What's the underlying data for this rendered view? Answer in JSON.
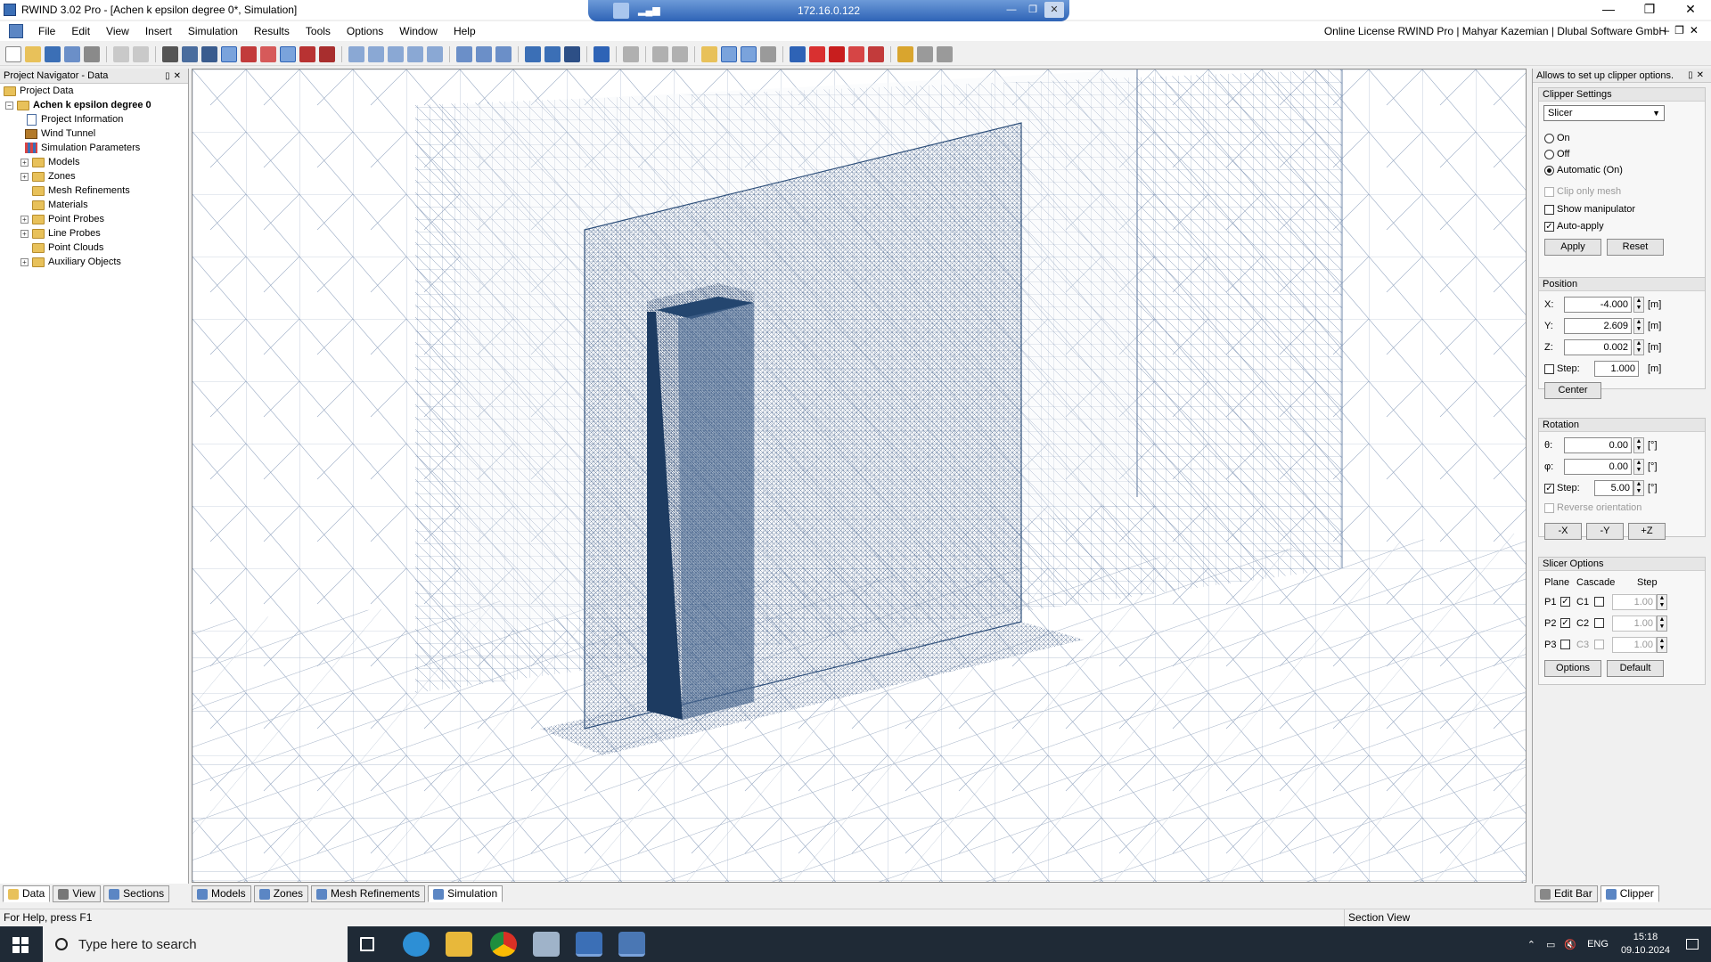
{
  "window": {
    "title": "RWIND 3.02 Pro - [Achen  k epsilon degree 0*, Simulation]",
    "remote_ip": "172.16.0.122"
  },
  "menu": {
    "items": [
      "File",
      "Edit",
      "View",
      "Insert",
      "Simulation",
      "Results",
      "Tools",
      "Options",
      "Window",
      "Help"
    ],
    "license": "Online License RWIND Pro | Mahyar Kazemian | Dlubal Software GmbH"
  },
  "navigator": {
    "title": "Project Navigator - Data",
    "root": "Project Data",
    "project": "Achen  k epsilon degree 0",
    "items": [
      {
        "label": "Project Information",
        "icon": "document-icon"
      },
      {
        "label": "Wind Tunnel",
        "icon": "wind-tunnel-icon"
      },
      {
        "label": "Simulation Parameters",
        "icon": "parameters-icon"
      },
      {
        "label": "Models",
        "icon": "folder-icon"
      },
      {
        "label": "Zones",
        "icon": "folder-icon"
      },
      {
        "label": "Mesh Refinements",
        "icon": "folder-icon"
      },
      {
        "label": "Materials",
        "icon": "folder-icon"
      },
      {
        "label": "Point Probes",
        "icon": "folder-icon"
      },
      {
        "label": "Line Probes",
        "icon": "folder-icon"
      },
      {
        "label": "Point Clouds",
        "icon": "folder-icon"
      },
      {
        "label": "Auxiliary Objects",
        "icon": "folder-icon"
      }
    ]
  },
  "clipper": {
    "panel_title": "Allows to set up clipper options.",
    "settings_title": "Clipper Settings",
    "mode": "Slicer",
    "radio_on": "On",
    "radio_off": "Off",
    "radio_auto": "Automatic (On)",
    "clip_only_mesh": "Clip only mesh",
    "show_manipulator": "Show manipulator",
    "auto_apply": "Auto-apply",
    "apply": "Apply",
    "reset": "Reset",
    "position_title": "Position",
    "x_label": "X:",
    "x_value": "-4.000",
    "y_label": "Y:",
    "y_value": "2.609",
    "z_label": "Z:",
    "z_value": "0.002",
    "step_label": "Step:",
    "step_value": "1.000",
    "unit_m": "[m]",
    "center": "Center",
    "rotation_title": "Rotation",
    "theta_label": "θ:",
    "theta_value": "0.00",
    "phi_label": "φ:",
    "phi_value": "0.00",
    "rot_step_label": "Step:",
    "rot_step_value": "5.00",
    "unit_deg": "[°]",
    "reverse_orientation": "Reverse orientation",
    "minus_x": "-X",
    "minus_y": "-Y",
    "plus_z": "+Z",
    "slicer_title": "Slicer Options",
    "col_plane": "Plane",
    "col_cascade": "Cascade",
    "col_step": "Step",
    "p1": "P1",
    "c1": "C1",
    "s1": "1.00",
    "p2": "P2",
    "c2": "C2",
    "s2": "1.00",
    "p3": "P3",
    "c3": "C3",
    "s3": "1.00",
    "options": "Options",
    "default": "Default"
  },
  "tabs": {
    "left": [
      "Data",
      "View",
      "Sections"
    ],
    "mid": [
      "Models",
      "Zones",
      "Mesh Refinements",
      "Simulation"
    ],
    "right": [
      "Edit Bar",
      "Clipper"
    ]
  },
  "status": {
    "help": "For Help, press F1",
    "mode": "Section View"
  },
  "taskbar": {
    "search_placeholder": "Type here to search",
    "lang": "ENG",
    "time": "15:18",
    "date": "09.10.2024"
  }
}
